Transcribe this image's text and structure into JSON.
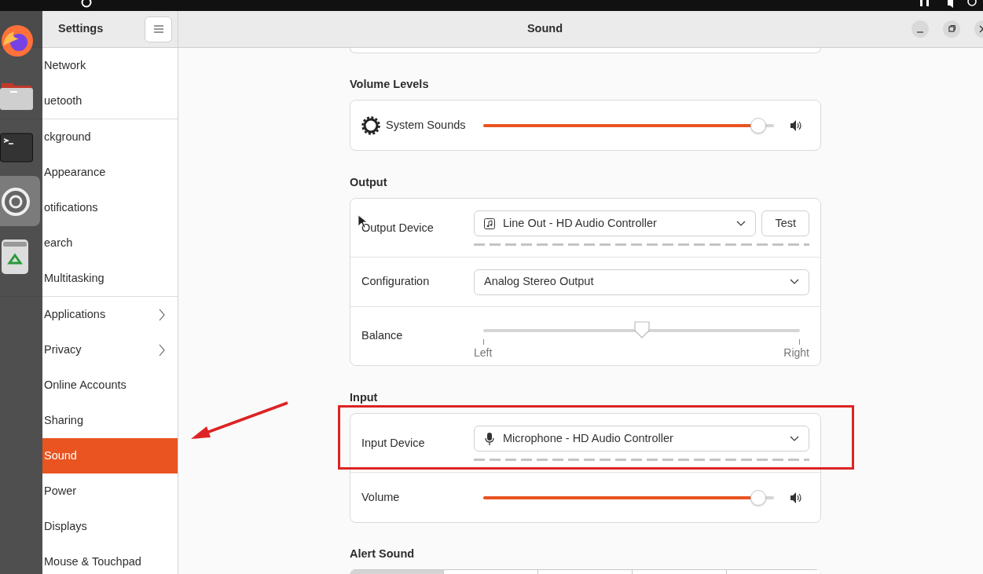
{
  "sidebar": {
    "title": "Settings",
    "groups": [
      {
        "items": [
          {
            "label": "Network",
            "selected": false,
            "submenu": false
          },
          {
            "label": "uetooth",
            "selected": false,
            "submenu": false
          }
        ]
      },
      {
        "items": [
          {
            "label": "ckground",
            "selected": false,
            "submenu": false
          },
          {
            "label": "Appearance",
            "selected": false,
            "submenu": false
          },
          {
            "label": "otifications",
            "selected": false,
            "submenu": false
          },
          {
            "label": "earch",
            "selected": false,
            "submenu": false
          },
          {
            "label": "Multitasking",
            "selected": false,
            "submenu": false
          }
        ]
      },
      {
        "items": [
          {
            "label": "Applications",
            "selected": false,
            "submenu": true
          },
          {
            "label": "Privacy",
            "selected": false,
            "submenu": true
          },
          {
            "label": "Online Accounts",
            "selected": false,
            "submenu": false
          },
          {
            "label": "Sharing",
            "selected": false,
            "submenu": false
          },
          {
            "label": "Sound",
            "selected": true,
            "submenu": false
          },
          {
            "label": "Power",
            "selected": false,
            "submenu": false
          },
          {
            "label": "Displays",
            "selected": false,
            "submenu": false
          },
          {
            "label": "Mouse & Touchpad",
            "selected": false,
            "submenu": false
          }
        ]
      }
    ]
  },
  "window": {
    "title": "Sound"
  },
  "sections": [
    {
      "heading": "Volume Levels",
      "rows": [
        {
          "kind": "slider",
          "label": "System Sounds",
          "level": 0.97
        }
      ]
    },
    {
      "heading": "Output",
      "rows": [
        {
          "kind": "device",
          "label": "Output Device",
          "value": "Line Out - HD Audio Controller",
          "button": "Test"
        },
        {
          "kind": "select",
          "label": "Configuration",
          "value": "Analog Stereo Output"
        },
        {
          "kind": "balance",
          "label": "Balance",
          "level": 0.5,
          "left": "Left",
          "right": "Right"
        }
      ]
    },
    {
      "heading": "Input",
      "rows": [
        {
          "kind": "device",
          "label": "Input Device",
          "value": "Microphone - HD Audio Controller"
        },
        {
          "kind": "slider",
          "label": "Volume",
          "level": 0.97
        }
      ]
    },
    {
      "heading": "Alert Sound",
      "segments": [
        {
          "selected": true
        },
        {
          "selected": false
        },
        {
          "selected": false
        },
        {
          "selected": false
        },
        {
          "selected": false
        }
      ]
    }
  ]
}
